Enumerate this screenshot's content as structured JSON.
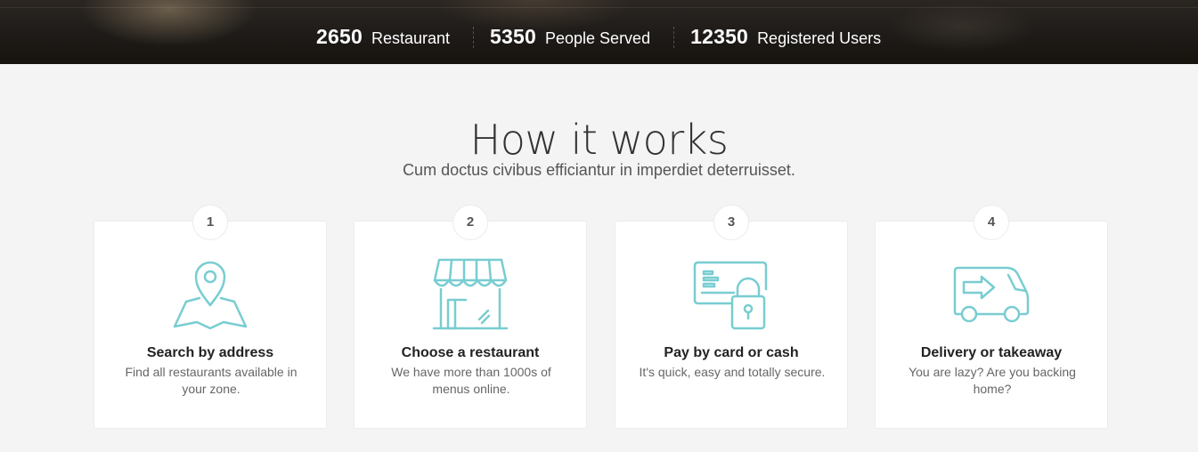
{
  "stats": [
    {
      "number": "2650",
      "label": "Restaurant"
    },
    {
      "number": "5350",
      "label": "People Served"
    },
    {
      "number": "12350",
      "label": "Registered Users"
    }
  ],
  "section": {
    "title": "How it works",
    "subtitle": "Cum doctus civibus efficiantur in imperdiet deterruisset."
  },
  "steps": [
    {
      "number": "1",
      "icon": "map-pin-icon",
      "title": "Search by address",
      "text": "Find all restaurants available in your zone."
    },
    {
      "number": "2",
      "icon": "storefront-icon",
      "title": "Choose a restaurant",
      "text": "We have more than 1000s of menus online."
    },
    {
      "number": "3",
      "icon": "card-lock-icon",
      "title": "Pay by card or cash",
      "text": "It's quick, easy and totally secure."
    },
    {
      "number": "4",
      "icon": "delivery-van-icon",
      "title": "Delivery or takeaway",
      "text": "You are lazy? Are you backing home?"
    }
  ],
  "colors": {
    "accent": "#78cdd1",
    "background": "#f4f4f4",
    "hero": "#1e1b18"
  }
}
